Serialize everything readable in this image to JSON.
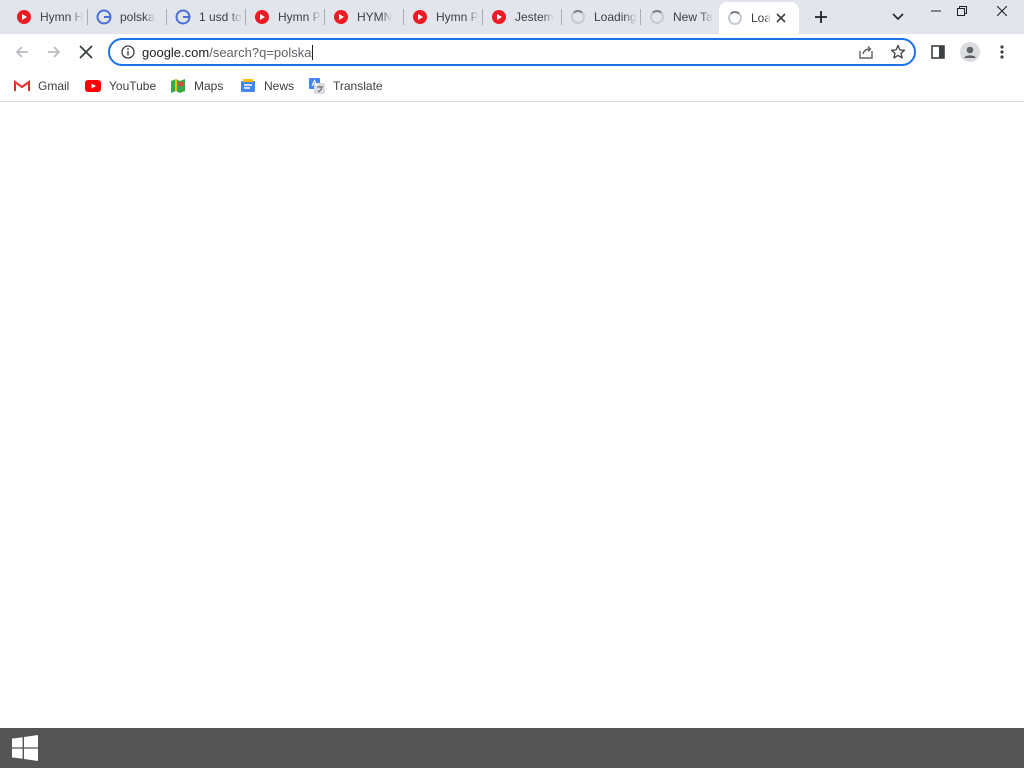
{
  "browser": {
    "tabs": [
      {
        "title": "Hymn H",
        "favicon": "youtube-icon"
      },
      {
        "title": "polska",
        "favicon": "google-icon"
      },
      {
        "title": "1 usd to",
        "favicon": "google-icon"
      },
      {
        "title": "Hymn P",
        "favicon": "youtube-icon"
      },
      {
        "title": "HYMN",
        "favicon": "youtube-icon"
      },
      {
        "title": "Hymn P",
        "favicon": "youtube-icon"
      },
      {
        "title": "Jestem",
        "favicon": "youtube-icon"
      },
      {
        "title": "Loading",
        "favicon": "loading-spinner-icon"
      },
      {
        "title": "New Ta",
        "favicon": "loading-spinner-icon"
      },
      {
        "title": "Loa",
        "favicon": "loading-spinner-icon",
        "active": true
      }
    ],
    "address_bar": {
      "host": "google.com",
      "path": "/search?q=polska"
    },
    "bookmarks": [
      {
        "label": "Gmail",
        "icon": "gmail-icon"
      },
      {
        "label": "YouTube",
        "icon": "youtube-icon"
      },
      {
        "label": "Maps",
        "icon": "maps-icon"
      },
      {
        "label": "News",
        "icon": "news-icon"
      },
      {
        "label": "Translate",
        "icon": "translate-icon"
      }
    ]
  },
  "colors": {
    "tabstrip_bg": "#e2e6ec",
    "omnibox_focus": "#1a73e8",
    "taskbar_bg": "#545454",
    "youtube_red": "#ee1b24"
  }
}
